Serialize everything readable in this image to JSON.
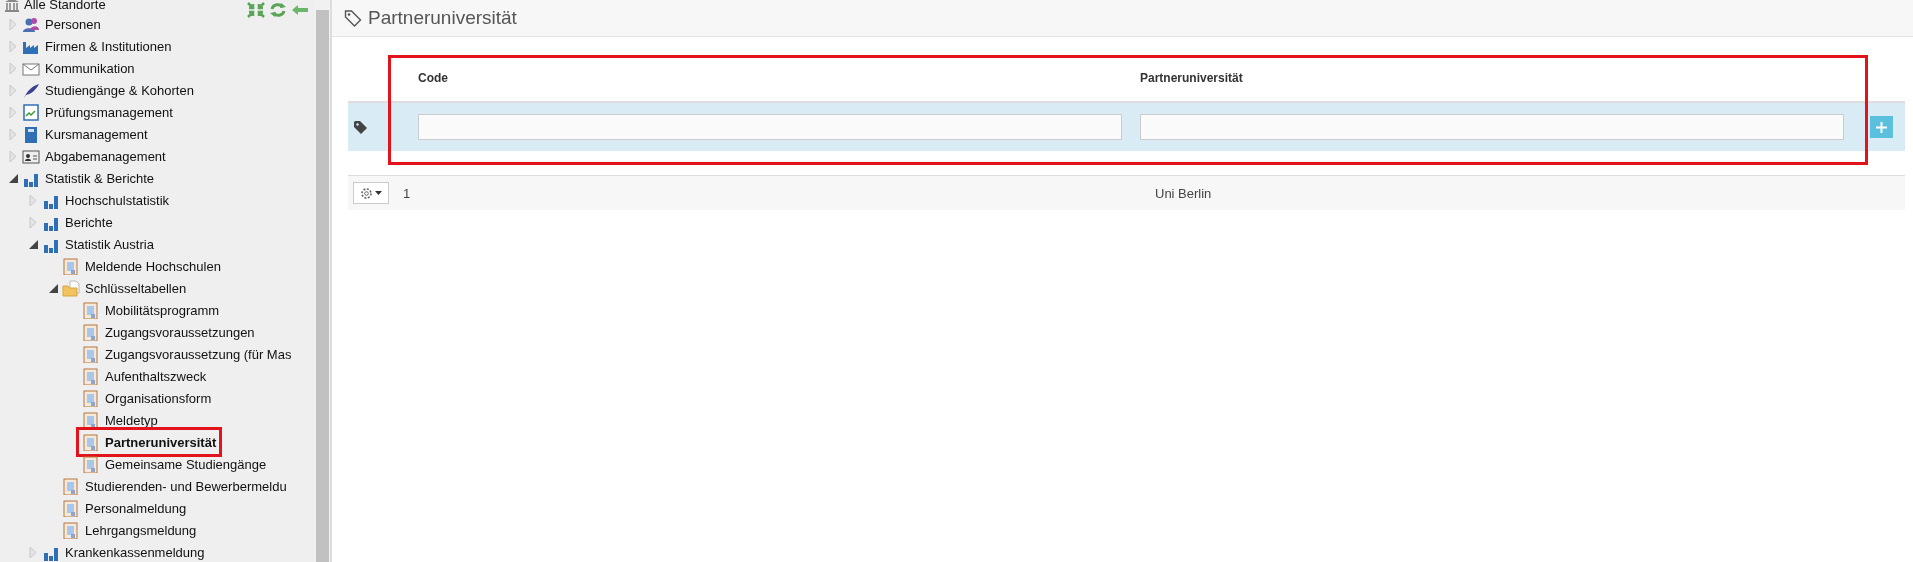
{
  "sidebar": {
    "root": {
      "label": "Alle Standorte"
    },
    "tree": [
      {
        "label": "Personen",
        "kind": "people",
        "expanded": false,
        "selected": false
      },
      {
        "label": "Firmen & Institutionen",
        "kind": "factory",
        "expanded": false,
        "selected": false
      },
      {
        "label": "Kommunikation",
        "kind": "mail",
        "expanded": false,
        "selected": false
      },
      {
        "label": "Studiengänge & Kohorten",
        "kind": "quill",
        "expanded": false,
        "selected": false
      },
      {
        "label": "Prüfungsmanagement",
        "kind": "chart-sheet",
        "expanded": false,
        "selected": false
      },
      {
        "label": "Kursmanagement",
        "kind": "book",
        "expanded": false,
        "selected": false
      },
      {
        "label": "Abgabemanagement",
        "kind": "id-card",
        "expanded": false,
        "selected": false
      },
      {
        "label": "Statistik & Berichte",
        "kind": "bars",
        "expanded": true,
        "selected": false,
        "children": [
          {
            "label": "Hochschulstatistik",
            "kind": "bars",
            "expanded": false,
            "selected": false
          },
          {
            "label": "Berichte",
            "kind": "bars",
            "expanded": false,
            "selected": false
          },
          {
            "label": "Statistik Austria",
            "kind": "bars",
            "expanded": true,
            "selected": false,
            "children": [
              {
                "label": "Meldende Hochschulen",
                "kind": "table",
                "selected": false
              },
              {
                "label": "Schlüsseltabellen",
                "kind": "folder",
                "expanded": true,
                "selected": false,
                "children": [
                  {
                    "label": "Mobilitätsprogramm",
                    "kind": "table",
                    "selected": false
                  },
                  {
                    "label": "Zugangsvoraussetzungen",
                    "kind": "table",
                    "selected": false
                  },
                  {
                    "label": "Zugangsvoraussetzung (für Mas",
                    "kind": "table",
                    "selected": false
                  },
                  {
                    "label": "Aufenthaltszweck",
                    "kind": "table",
                    "selected": false
                  },
                  {
                    "label": "Organisationsform",
                    "kind": "table",
                    "selected": false
                  },
                  {
                    "label": "Meldetyp",
                    "kind": "table",
                    "selected": false
                  },
                  {
                    "label": "Partneruniversität",
                    "kind": "table",
                    "selected": true
                  },
                  {
                    "label": "Gemeinsame Studiengänge",
                    "kind": "table",
                    "selected": false
                  }
                ]
              },
              {
                "label": "Studierenden- und Bewerbermeldu",
                "kind": "table",
                "selected": false
              },
              {
                "label": "Personalmeldung",
                "kind": "table",
                "selected": false
              },
              {
                "label": "Lehrgangsmeldung",
                "kind": "table",
                "selected": false
              }
            ]
          },
          {
            "label": "Krankenkassenmeldung",
            "kind": "bars",
            "expanded": false,
            "selected": false
          }
        ]
      }
    ]
  },
  "page": {
    "title": "Partneruniversität"
  },
  "table": {
    "columns": [
      "Code",
      "Partneruniversität"
    ],
    "highlighted": true,
    "rows": [
      {
        "cells": [
          "1",
          "Uni Berlin"
        ]
      }
    ]
  }
}
